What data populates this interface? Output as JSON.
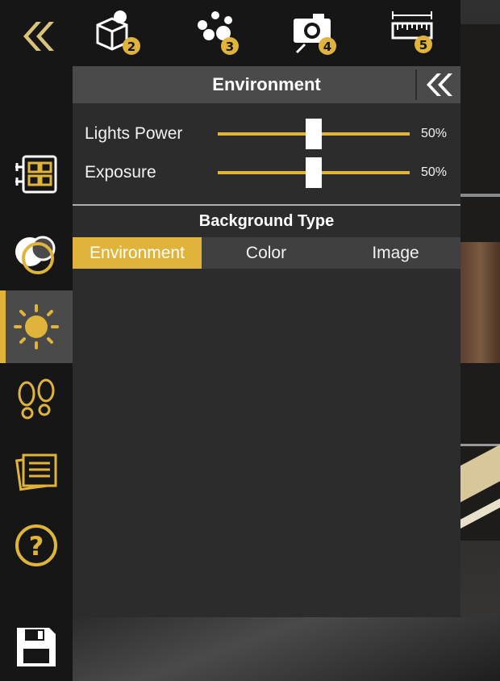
{
  "colors": {
    "accent": "#e0b43a",
    "panel_bg": "#2c2c2c",
    "header_bg": "#4a4a4a",
    "sidebar_bg": "#161616"
  },
  "toolbar": {
    "collapse_icon": "double-chevron-left-icon",
    "items": [
      {
        "icon": "shapes-icon",
        "badge": "2"
      },
      {
        "icon": "nodes-icon",
        "badge": "3"
      },
      {
        "icon": "camera-icon",
        "badge": "4"
      },
      {
        "icon": "ruler-icon",
        "badge": "5"
      }
    ]
  },
  "sidebar": {
    "items": [
      {
        "icon": "layout-grid-icon"
      },
      {
        "icon": "materials-icon"
      },
      {
        "icon": "sun-icon",
        "active": true
      },
      {
        "icon": "footprints-icon"
      },
      {
        "icon": "notes-icon"
      },
      {
        "icon": "help-icon"
      },
      {
        "icon": "save-icon"
      }
    ]
  },
  "panel": {
    "title": "Environment",
    "sliders": [
      {
        "label": "Lights Power",
        "value": "50%",
        "level": 0.5
      },
      {
        "label": "Exposure",
        "value": "50%",
        "level": 0.5
      }
    ],
    "background_type": {
      "title": "Background Type",
      "options": [
        "Environment",
        "Color",
        "Image"
      ],
      "selected": "Environment"
    }
  }
}
